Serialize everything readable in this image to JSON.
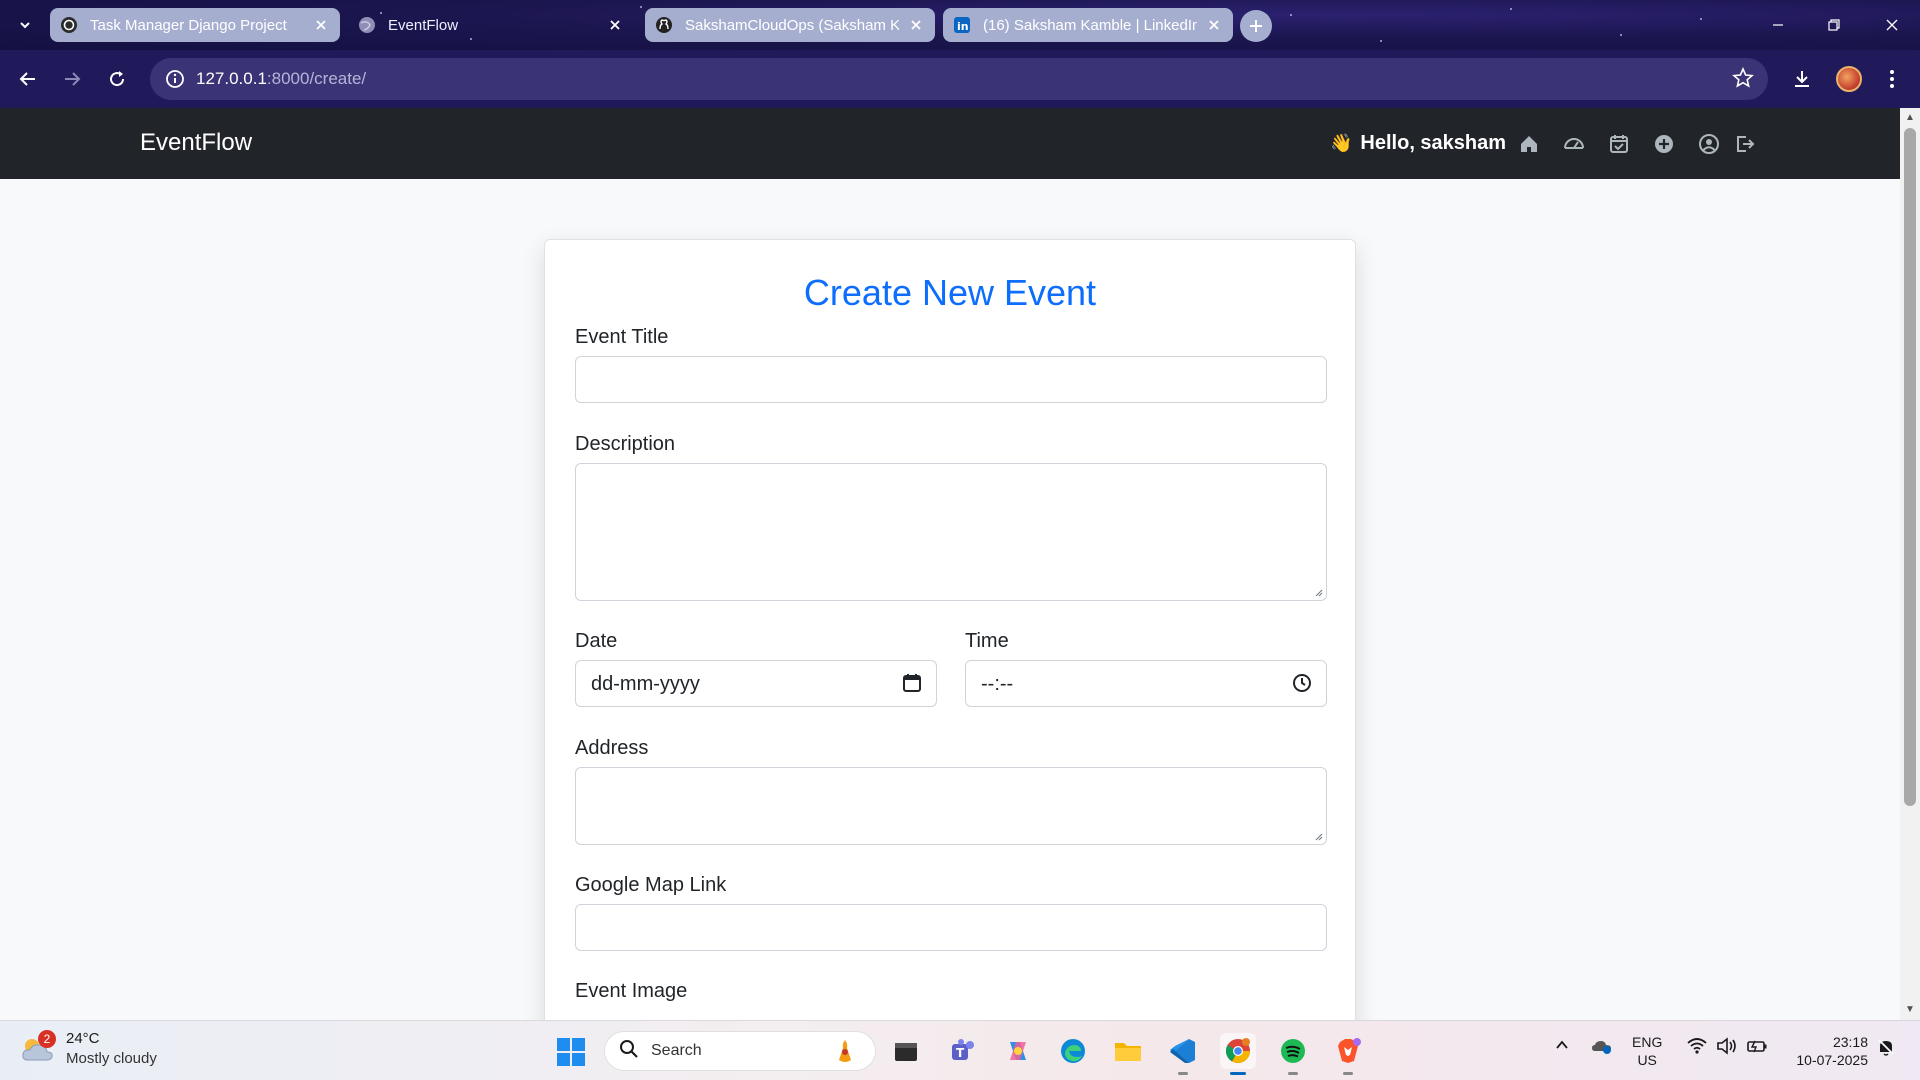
{
  "browser": {
    "tabs": [
      {
        "title": "Task Manager Django Project",
        "state": "inactive",
        "icon": "openai-icon"
      },
      {
        "title": "EventFlow",
        "state": "active",
        "icon": "globe-icon"
      },
      {
        "title": "SakshamCloudOps (Saksham K",
        "state": "inactive",
        "icon": "github-icon"
      },
      {
        "title": "(16) Saksham Kamble | LinkedIn",
        "state": "inactive",
        "icon": "linkedin-icon"
      }
    ],
    "url_host": "127.0.0.1",
    "url_path": ":8000/create/"
  },
  "navbar": {
    "brand": "EventFlow",
    "greeting_emoji": "👋",
    "greeting": "Hello, saksham",
    "icons": [
      "home-icon",
      "dashboard-icon",
      "calendar-check-icon",
      "add-circle-icon",
      "user-circle-icon",
      "logout-icon"
    ]
  },
  "form": {
    "title": "Create New Event",
    "event_title_label": "Event Title",
    "event_title_value": "",
    "description_label": "Description",
    "description_value": "",
    "date_label": "Date",
    "date_placeholder": "dd-mm-yyyy",
    "time_label": "Time",
    "time_placeholder": "--:--",
    "address_label": "Address",
    "address_value": "",
    "map_link_label": "Google Map Link",
    "map_link_value": "",
    "image_label": "Event Image"
  },
  "taskbar": {
    "weather_badge": "2",
    "temperature": "24°C",
    "condition": "Mostly cloudy",
    "search_placeholder": "Search",
    "apps": [
      "file-explorer-icon",
      "teams-icon",
      "copilot-icon",
      "edge-icon",
      "folder-icon",
      "vscode-icon",
      "chrome-icon",
      "spotify-icon",
      "brave-icon"
    ],
    "lang_line1": "ENG",
    "lang_line2": "US",
    "time": "23:18",
    "date": "10-07-2025"
  },
  "colors": {
    "accent": "#0d6efd",
    "navbar_bg": "#212529",
    "page_bg": "#f8f9fa",
    "chrome_bg": "#1c1650"
  }
}
